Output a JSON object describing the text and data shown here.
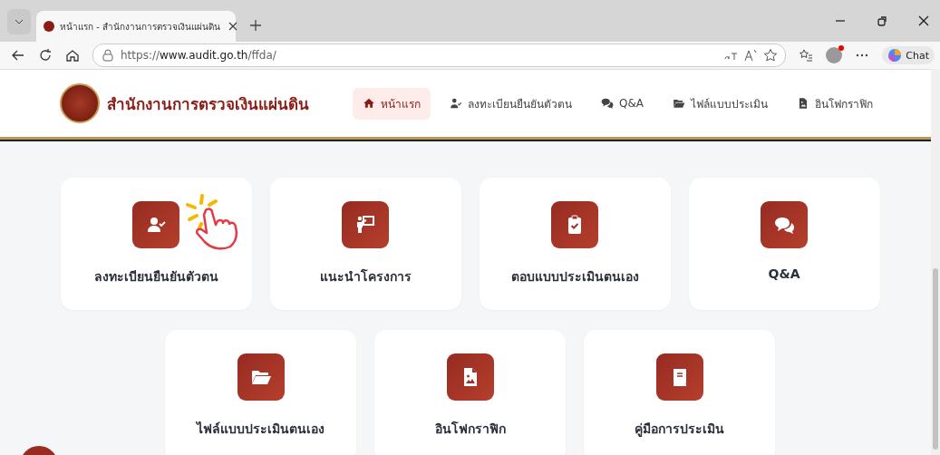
{
  "browser": {
    "tab": {
      "title": "หน้าแรก - สำนักงานการตรวจเงินแผ่นดิน",
      "selected": true
    },
    "address": {
      "scheme": "https://",
      "host": "www.audit.go.th",
      "path": "/ffda/"
    },
    "chat_label": "Chat"
  },
  "site": {
    "name": "สำนักงานการตรวจเงินแผ่นดิน"
  },
  "nav": [
    {
      "label": "หน้าแรก",
      "selected": true
    },
    {
      "label": "ลงทะเบียนยืนยันตัวตน",
      "selected": false
    },
    {
      "label": "Q&A",
      "selected": false
    },
    {
      "label": "ไฟล์แบบประเมิน",
      "selected": false
    },
    {
      "label": "อินโฟกราฟิก",
      "selected": false
    }
  ],
  "cards": [
    {
      "label": "ลงทะเบียนยืนยันตัวตน",
      "tap_hint": true
    },
    {
      "label": "แนะนำโครงการ",
      "tap_hint": false
    },
    {
      "label": "ตอบแบบประเมินตนเอง",
      "tap_hint": false
    },
    {
      "label": "Q&A",
      "tap_hint": false
    },
    {
      "label": "ไฟล์แบบประเมินตนเอง",
      "tap_hint": false
    },
    {
      "label": "อินโฟกราฟิก",
      "tap_hint": false
    },
    {
      "label": "คู่มือการประเมิน",
      "tap_hint": false
    }
  ]
}
